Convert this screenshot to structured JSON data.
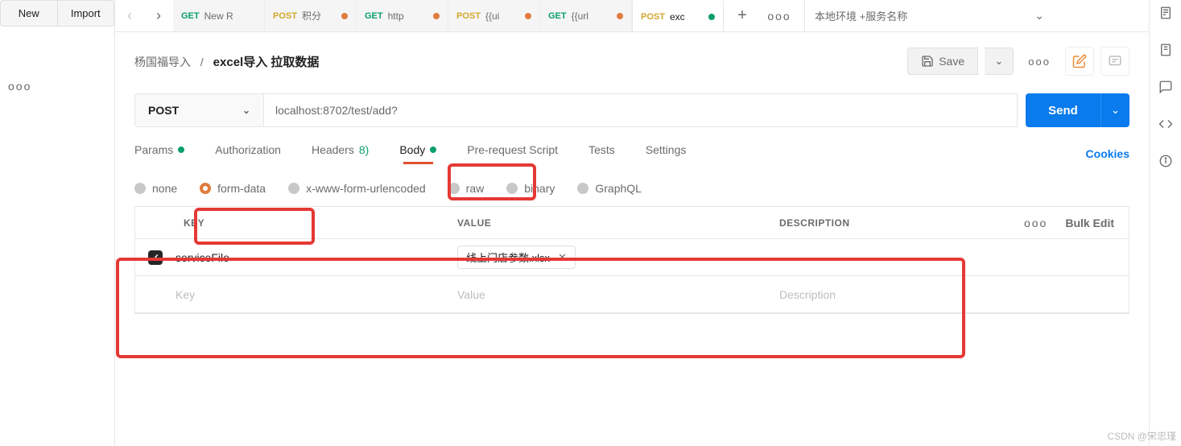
{
  "sidebar": {
    "new_label": "New",
    "import_label": "Import",
    "more": "ooo"
  },
  "tabs": {
    "items": [
      {
        "method": "GET",
        "method_class": "get",
        "title": "New R",
        "dot": null
      },
      {
        "method": "POST",
        "method_class": "post",
        "title": "积分",
        "dot": "orange"
      },
      {
        "method": "GET",
        "method_class": "get",
        "title": "http",
        "dot": "orange"
      },
      {
        "method": "POST",
        "method_class": "post",
        "title": "{{ui",
        "dot": "orange"
      },
      {
        "method": "GET",
        "method_class": "get",
        "title": "{{url",
        "dot": "orange"
      },
      {
        "method": "POST",
        "method_class": "post",
        "title": "exc",
        "dot": "green"
      }
    ],
    "env": "本地环境 +服务名称"
  },
  "breadcrumb": {
    "folder": "杨国福导入",
    "sep": "/",
    "current": "excel导入 拉取数据"
  },
  "toolbar": {
    "save_label": "Save",
    "more": "ooo"
  },
  "request": {
    "method": "POST",
    "url": "localhost:8702/test/add?",
    "send_label": "Send"
  },
  "req_tabs": {
    "params": "Params",
    "authorization": "Authorization",
    "headers": "Headers",
    "headers_count": "8)",
    "body": "Body",
    "prerequest": "Pre-request Script",
    "tests": "Tests",
    "settings": "Settings",
    "cookies": "Cookies"
  },
  "body_types": {
    "none": "none",
    "form_data": "form-data",
    "urlencoded": "x-www-form-urlencoded",
    "raw": "raw",
    "binary": "binary",
    "graphql": "GraphQL"
  },
  "fd": {
    "headers": {
      "key": "KEY",
      "value": "VALUE",
      "description": "DESCRIPTION",
      "bulk_edit": "Bulk Edit"
    },
    "rows": [
      {
        "checked": true,
        "key": "serviceFile",
        "file": "线上门店参数.xlsx",
        "description": ""
      }
    ],
    "placeholders": {
      "key": "Key",
      "value": "Value",
      "description": "Description"
    }
  },
  "watermark": "CSDN @宋忠瑾"
}
